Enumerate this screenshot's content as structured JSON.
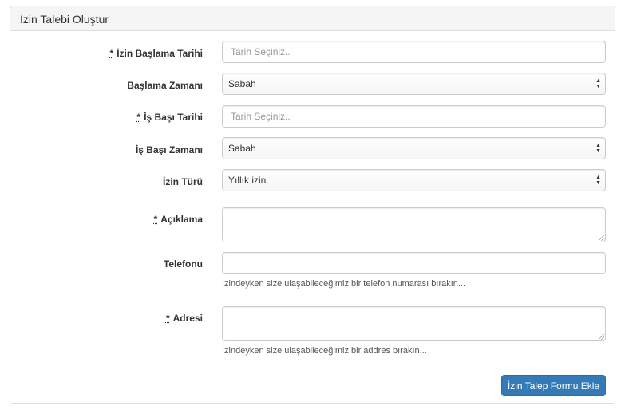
{
  "panel": {
    "title": "İzin Talebi Oluştur"
  },
  "form": {
    "required_mark": "*",
    "start_date": {
      "label": "İzin Başlama Tarihi",
      "placeholder": "Tarih Seçiniz..",
      "value": ""
    },
    "start_time": {
      "label": "Başlama Zamanı",
      "selected": "Sabah"
    },
    "return_date": {
      "label": "İş Başı Tarihi",
      "placeholder": "Tarih Seçiniz..",
      "value": ""
    },
    "return_time": {
      "label": "İş Başı Zamanı",
      "selected": "Sabah"
    },
    "leave_type": {
      "label": "İzin Türü",
      "selected": "Yıllık izin"
    },
    "description": {
      "label": "Açıklama",
      "value": ""
    },
    "phone": {
      "label": "Telefonu",
      "value": "",
      "help": "İzindeyken size ulaşabileceğimiz bir telefon numarası bırakın..."
    },
    "address": {
      "label": "Adresi",
      "value": "",
      "help": "İzindeyken size ulaşabileceğimiz bir addres bırakın..."
    },
    "submit_label": "İzin Talep Formu Ekle"
  },
  "colors": {
    "primary": "#337ab7",
    "border": "#dddddd",
    "heading_bg": "#f5f5f5"
  },
  "icons": {
    "select_arrows": "up-down-arrows-icon",
    "resize": "resize-grip-icon"
  }
}
